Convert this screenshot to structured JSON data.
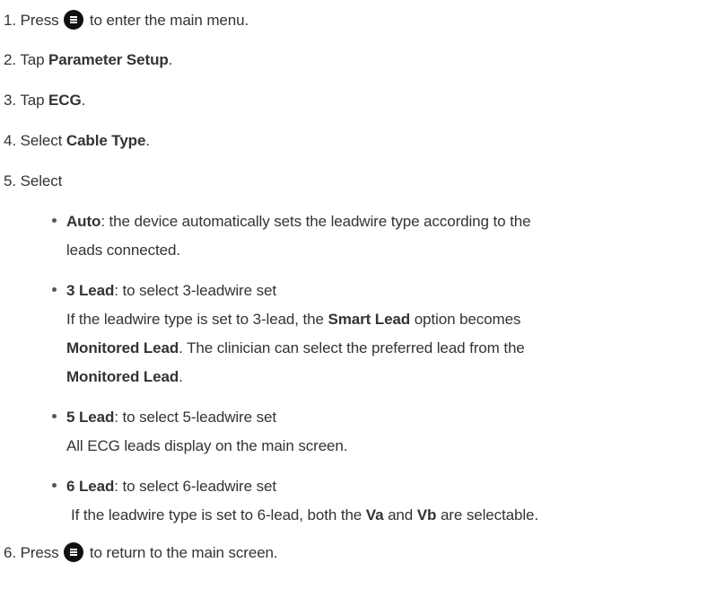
{
  "steps": {
    "s1": {
      "num": "1.",
      "pre": "Press",
      "post": "to enter the main menu."
    },
    "s2": {
      "num": "2.",
      "pre": "Tap",
      "bold": "Parameter Setup",
      "post": "."
    },
    "s3": {
      "num": "3.",
      "pre": "Tap",
      "bold": "ECG",
      "post": "."
    },
    "s4": {
      "num": "4.",
      "pre": "Select",
      "bold": "Cable Type",
      "post": "."
    },
    "s5": {
      "num": "5.",
      "text": "Select"
    },
    "s6": {
      "num": "6.",
      "pre": "Press",
      "post": "to return to the main screen."
    }
  },
  "options": {
    "auto": {
      "bold": "Auto",
      "text1": ": the device automatically sets the leadwire type according to the",
      "text2": "leads connected."
    },
    "lead3": {
      "bold": "3 Lead",
      "text": ": to select 3-leadwire set",
      "note_pre": "If the leadwire type is set to 3-lead, the",
      "note_bold1": "Smart Lead",
      "note_mid": "option becomes",
      "note_bold2": "Monitored Lead",
      "note_post": ". The clinician can select the preferred lead from the",
      "note_bold3": "Monitored Lead",
      "note_end": "."
    },
    "lead5": {
      "bold": "5 Lead",
      "text": ": to select 5-leadwire set",
      "note": "All ECG leads display on the main screen."
    },
    "lead6": {
      "bold": "6 Lead",
      "text": ": to select 6-leadwire set",
      "note_pre": "If the leadwire type is set to 6-lead, both the",
      "note_bold1": "Va",
      "note_mid": "and",
      "note_bold2": "Vb",
      "note_post": "are selectable."
    }
  },
  "icons": {
    "menu_key": "menu-key-icon",
    "bullet": "bullet-icon"
  },
  "colors": {
    "text": "#333333",
    "key": "#111111"
  }
}
